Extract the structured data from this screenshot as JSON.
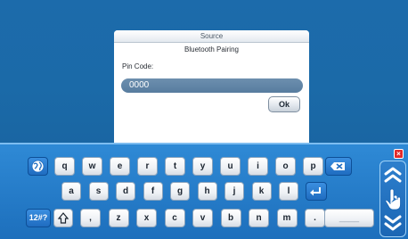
{
  "dialog": {
    "title": "Source",
    "subtitle": "Bluetooth Pairing",
    "pin_label": "Pin Code:",
    "pin_value": "0000",
    "ok_label": "Ok"
  },
  "keyboard": {
    "row1": [
      "q",
      "w",
      "e",
      "r",
      "t",
      "y",
      "u",
      "i",
      "o",
      "p"
    ],
    "row2": [
      "a",
      "s",
      "d",
      "f",
      "g",
      "h",
      "j",
      "k",
      "l"
    ],
    "row3": [
      ",",
      "z",
      "x",
      "c",
      "v",
      "b",
      "n",
      "m",
      "."
    ],
    "mode_label": "12#?",
    "space_label": "____"
  },
  "icons": {
    "globe": "globe-icon",
    "backspace": "backspace-icon",
    "enter": "enter-icon",
    "shift": "shift-icon",
    "close": "close-icon",
    "scroll": "scroll-hand-icon"
  },
  "colors": {
    "background": "#1d6aa9",
    "keyboard": "#2f8ad6",
    "accent_key": "#1f6cc0",
    "close": "#e32a2a"
  }
}
